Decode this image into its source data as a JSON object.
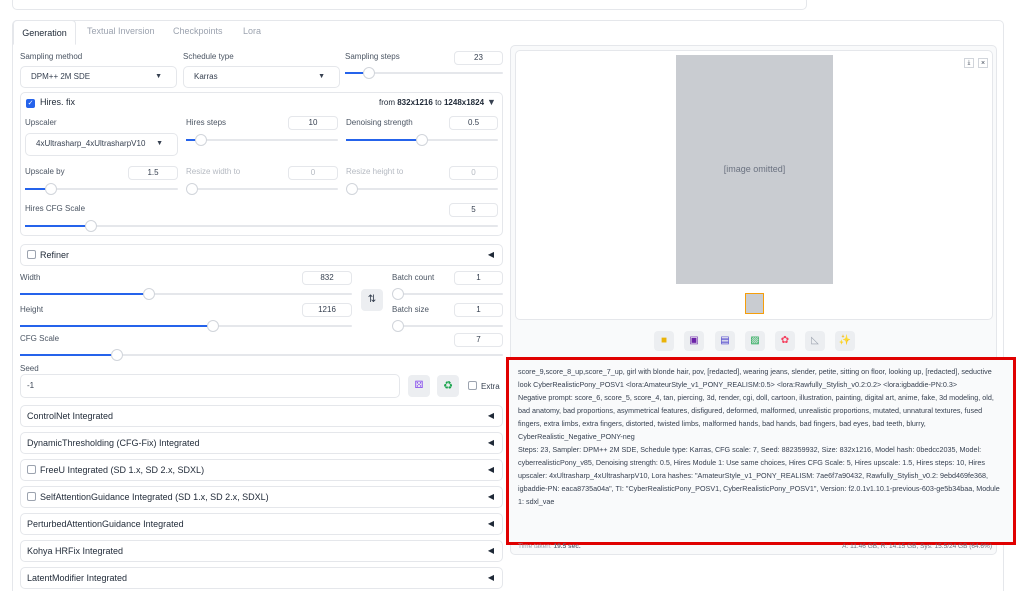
{
  "tabs": [
    "Generation",
    "Textual Inversion",
    "Checkpoints",
    "Lora"
  ],
  "sampling": {
    "method_label": "Sampling method",
    "method": "DPM++ 2M SDE",
    "schedule_label": "Schedule type",
    "schedule": "Karras",
    "steps_label": "Sampling steps",
    "steps": "23",
    "steps_fraction": 0.15
  },
  "hires": {
    "label": "Hires. fix",
    "enabled": true,
    "from_text": "from",
    "from": "832x1216",
    "to_text": "to",
    "to": "1248x1824",
    "upscaler_label": "Upscaler",
    "upscaler": "4xUltrasharp_4xUltrasharpV10",
    "steps_label": "Hires steps",
    "steps": "10",
    "steps_fraction": 0.1,
    "denoise_label": "Denoising strength",
    "denoise": "0.5",
    "denoise_fraction": 0.5,
    "upscale_by_label": "Upscale by",
    "upscale_by": "1.5",
    "upscale_fraction": 0.17,
    "resize_w_label": "Resize width to",
    "resize_w": "0",
    "resize_h_label": "Resize height to",
    "resize_h": "0",
    "cfg_label": "Hires CFG Scale",
    "cfg": "5",
    "cfg_fraction": 0.14
  },
  "refiner": {
    "label": "Refiner"
  },
  "size": {
    "width_label": "Width",
    "width": "832",
    "width_fraction": 0.39,
    "height_label": "Height",
    "height": "1216",
    "height_fraction": 0.58,
    "batch_count_label": "Batch count",
    "batch_count": "1",
    "batch_size_label": "Batch size",
    "batch_size": "1"
  },
  "cfg": {
    "label": "CFG Scale",
    "value": "7",
    "fraction": 0.2
  },
  "seed": {
    "label": "Seed",
    "value": "-1",
    "extra_label": "Extra"
  },
  "accordions": [
    {
      "label": "ControlNet Integrated",
      "checkbox": false
    },
    {
      "label": "DynamicThresholding (CFG-Fix) Integrated",
      "checkbox": false
    },
    {
      "label": "FreeU Integrated (SD 1.x, SD 2.x, SDXL)",
      "checkbox": true
    },
    {
      "label": "SelfAttentionGuidance Integrated (SD 1.x, SD 2.x, SDXL)",
      "checkbox": true
    },
    {
      "label": "PerturbedAttentionGuidance Integrated",
      "checkbox": false
    },
    {
      "label": "Kohya HRFix Integrated",
      "checkbox": false
    },
    {
      "label": "LatentModifier Integrated",
      "checkbox": false
    }
  ],
  "output": {
    "image_placeholder": "[image omitted]",
    "info_lines": [
      "score_9,score_8_up,score_7_up, girl with blonde hair, pov, [redacted], wearing jeans, slender, petite, sitting on floor, looking up, [redacted], seductive look CyberRealisticPony_POSV1 <lora:AmateurStyle_v1_PONY_REALISM:0.5> <lora:Rawfully_Stylish_v0.2:0.2> <lora:igbaddie-PN:0.3>",
      "Negative prompt: score_6, score_5, score_4, tan, piercing, 3d, render, cgi, doll, cartoon, illustration, painting, digital art, anime, fake, 3d modeling, old, bad anatomy, bad proportions, asymmetrical features, disfigured, deformed, malformed, unrealistic proportions, mutated, unnatural textures, fused fingers, extra limbs, extra fingers, distorted, twisted limbs, malformed hands, bad hands, bad fingers, bad eyes, bad teeth, blurry,",
      "CyberRealistic_Negative_PONY-neg",
      "Steps: 23, Sampler: DPM++ 2M SDE, Schedule type: Karras, CFG scale: 7, Seed: 882359932, Size: 832x1216, Model hash: 0bedcc2035, Model: cyberrealisticPony_v85, Denoising strength: 0.5, Hires Module 1: Use same choices, Hires CFG Scale: 5, Hires upscale: 1.5, Hires steps: 10, Hires upscaler: 4xUltrasharp_4xUltrasharpV10, Lora hashes: \"AmateurStyle_v1_PONY_REALISM: 7ae6f7a90432, Rawfully_Stylish_v0.2: 9ebd469fe368, igbaddie-PN: eaca8735a04a\", TI: \"CyberRealisticPony_POSV1, CyberRealisticPony_POSV1\", Version: f2.0.1v1.10.1-previous-603-ge5b34baa, Module 1: sdxl_vae"
    ],
    "time_taken_label": "Time taken:",
    "time_taken": "19.5 sec.",
    "vram": "A: 11.46 GB, R: 14.15 GB, Sys: 15.5/24 GB (64.6%)"
  },
  "toolbar_icons": [
    "folder-icon",
    "save-icon",
    "zip-icon",
    "image-icon",
    "palette-icon",
    "ruler-icon",
    "sparkle-icon"
  ],
  "highlight_color": "#e00000",
  "accent": "#2563eb"
}
